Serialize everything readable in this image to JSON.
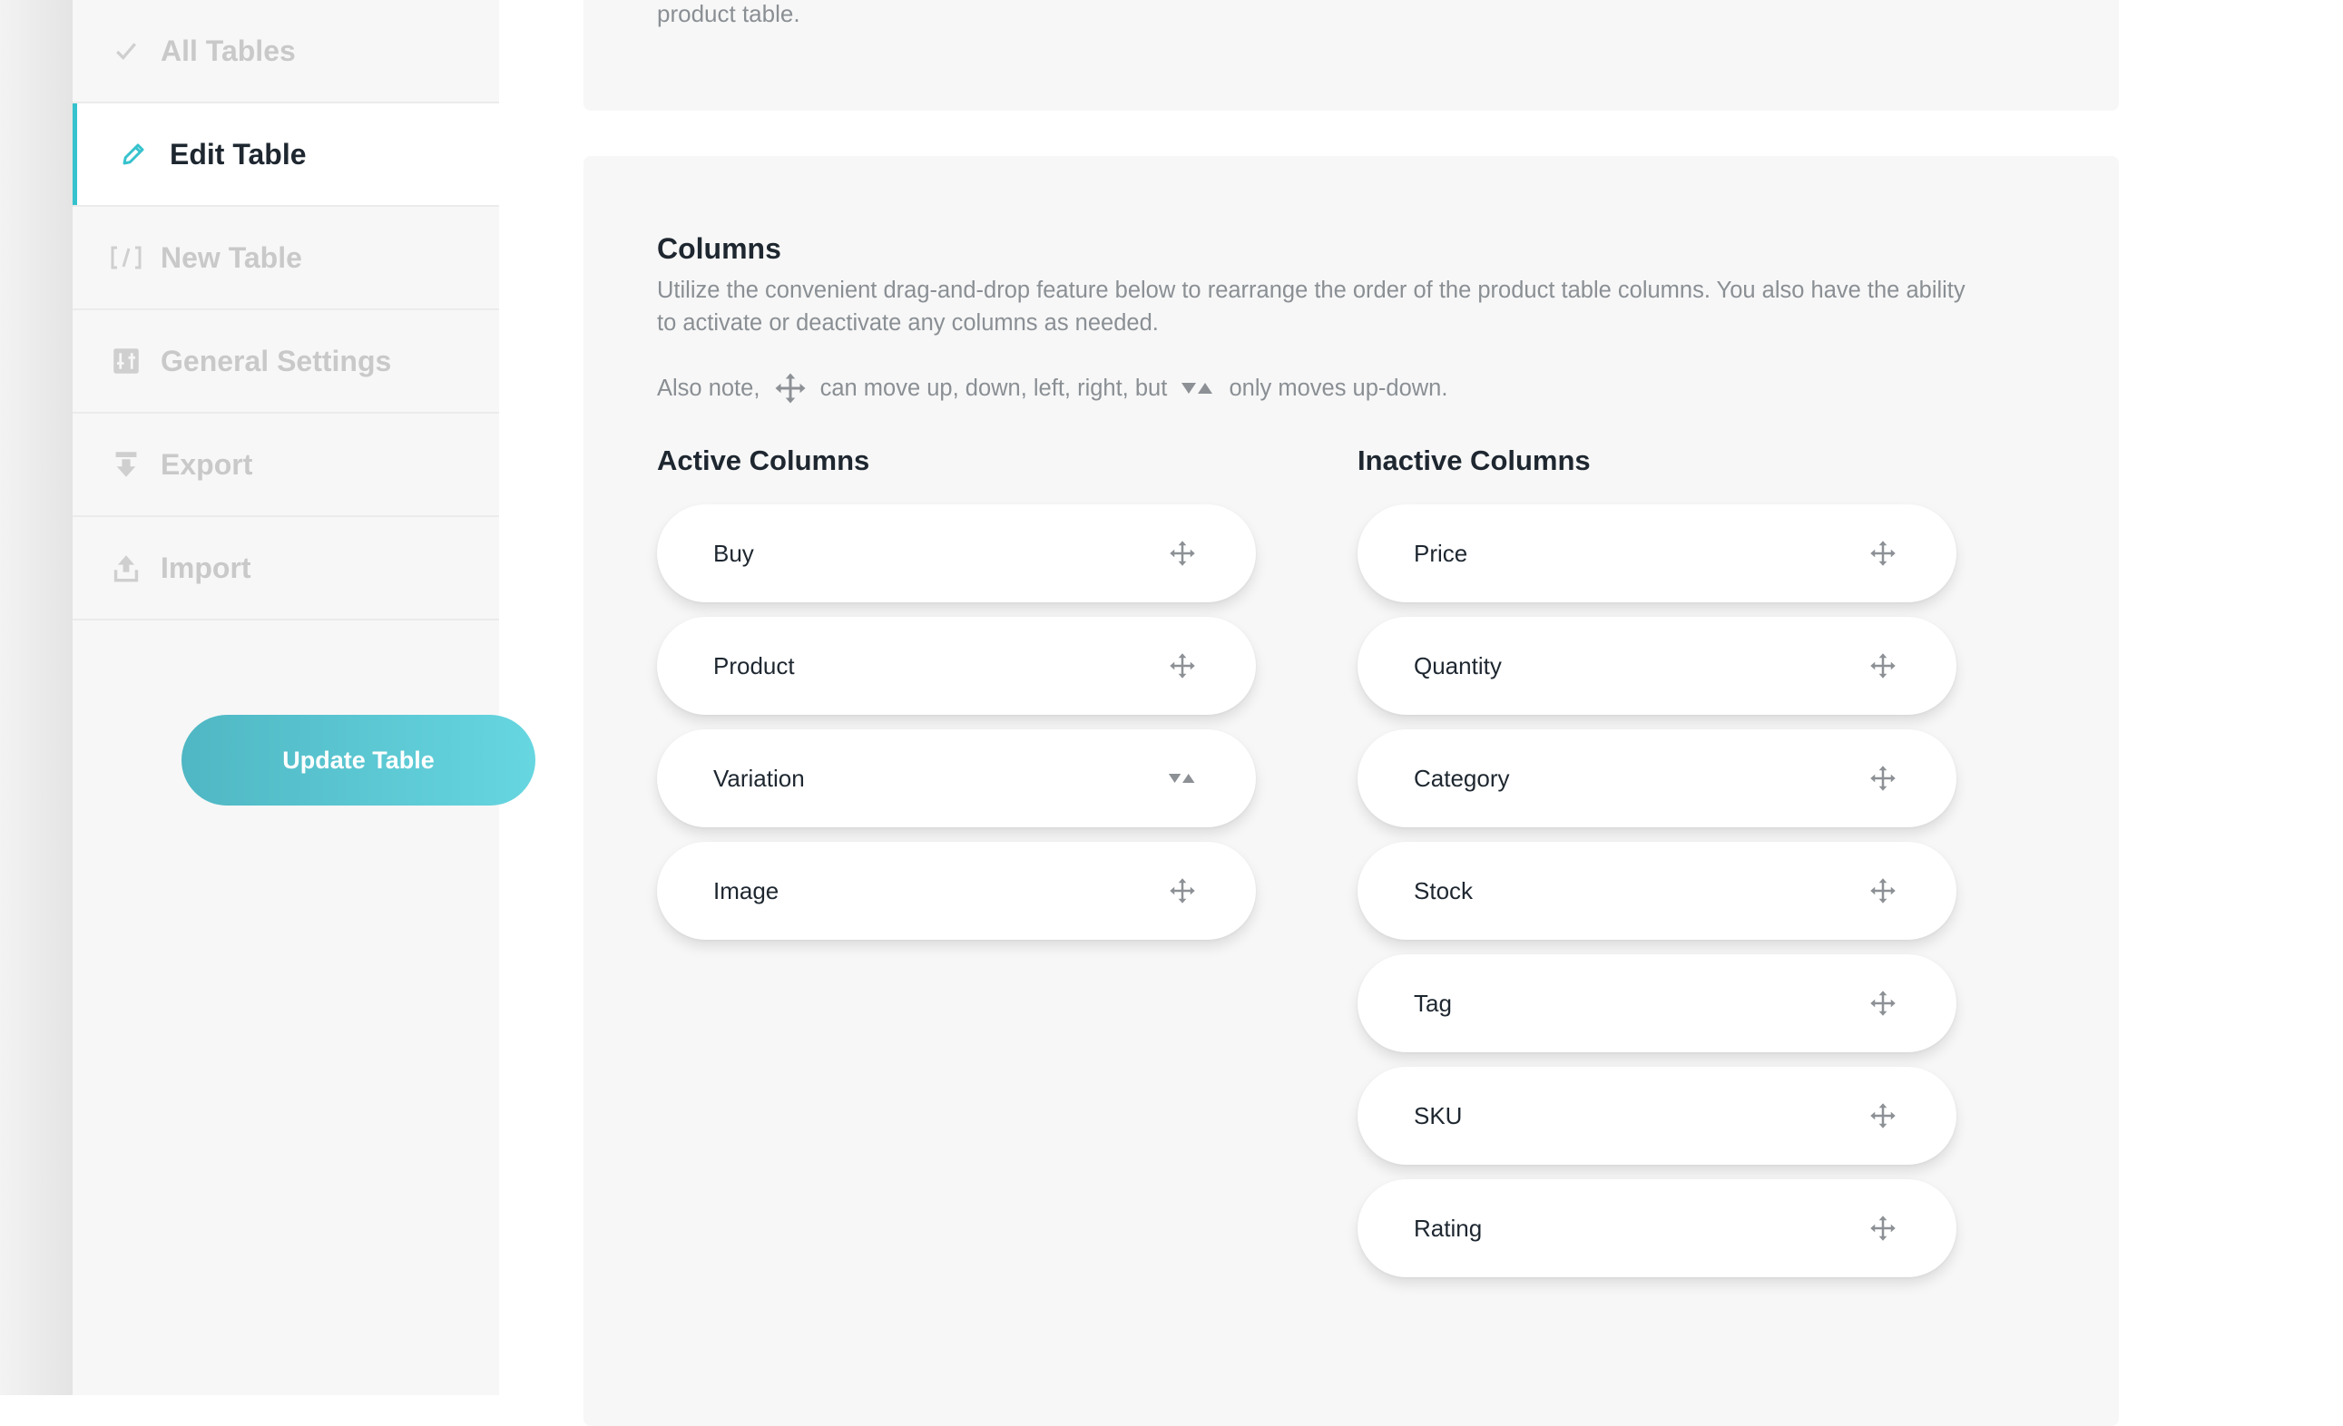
{
  "sidebar": {
    "items": [
      {
        "label": "All Tables",
        "icon": "check-icon"
      },
      {
        "label": "Edit Table",
        "icon": "pencil-icon"
      },
      {
        "label": "New Table",
        "icon": "code-brackets-icon"
      },
      {
        "label": "General Settings",
        "icon": "settings-panel-icon"
      },
      {
        "label": "Export",
        "icon": "export-icon"
      },
      {
        "label": "Import",
        "icon": "import-icon"
      }
    ],
    "active_item": "Edit Table",
    "update_button": "Update Table"
  },
  "previous_section": {
    "text_tail": "product table."
  },
  "columns": {
    "title": "Columns",
    "description": "Utilize the convenient drag-and-drop feature below to rearrange the order of the product table columns. You also have the ability to activate or deactivate any columns as needed.",
    "note": {
      "prefix": "Also note, ",
      "middle": " can move up, down, left, right, but ",
      "suffix": " only moves up-down."
    },
    "active_heading": "Active Columns",
    "inactive_heading": "Inactive Columns",
    "active": [
      {
        "label": "Buy",
        "handle": "move-icon"
      },
      {
        "label": "Product",
        "handle": "move-icon"
      },
      {
        "label": "Variation",
        "handle": "up-down-icon"
      },
      {
        "label": "Image",
        "handle": "move-icon"
      }
    ],
    "inactive": [
      {
        "label": "Price",
        "handle": "move-icon"
      },
      {
        "label": "Quantity",
        "handle": "move-icon"
      },
      {
        "label": "Category",
        "handle": "move-icon"
      },
      {
        "label": "Stock",
        "handle": "move-icon"
      },
      {
        "label": "Tag",
        "handle": "move-icon"
      },
      {
        "label": "SKU",
        "handle": "move-icon"
      },
      {
        "label": "Rating",
        "handle": "move-icon"
      }
    ]
  },
  "colors": {
    "accent": "#35c2cd",
    "button_gradient_start": "#4fb7c3",
    "button_gradient_end": "#66d6e0",
    "heading": "#1e2730",
    "muted": "#8a8f94"
  }
}
